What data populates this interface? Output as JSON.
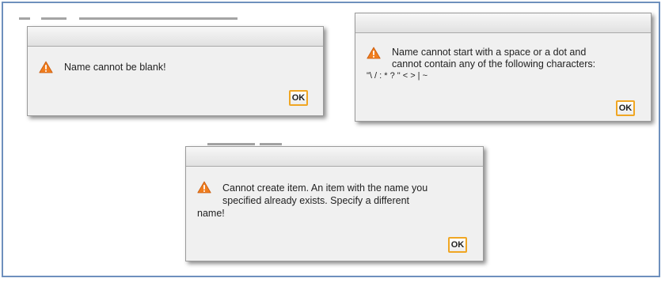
{
  "dialogs": {
    "blank_name": {
      "lines": [
        "Name cannot be blank!"
      ],
      "ok_label": "OK"
    },
    "invalid_chars": {
      "lines": [
        "Name cannot start with a space or a dot and",
        "cannot contain any of the following characters:",
        "\"\\ / : * ? \" < > | ~"
      ],
      "ok_label": "OK"
    },
    "duplicate_name": {
      "lines": [
        "Cannot create item. An item with the name you",
        "specified already exists. Specify a different",
        "name!"
      ],
      "ok_label": "OK"
    }
  },
  "icons": {
    "warning": "warning-triangle-icon"
  },
  "colors": {
    "frame_border": "#6e90bd",
    "dialog_background": "#f0f0f0",
    "warning_orange": "#f07d1e",
    "ok_button_border": "#f0a623"
  }
}
